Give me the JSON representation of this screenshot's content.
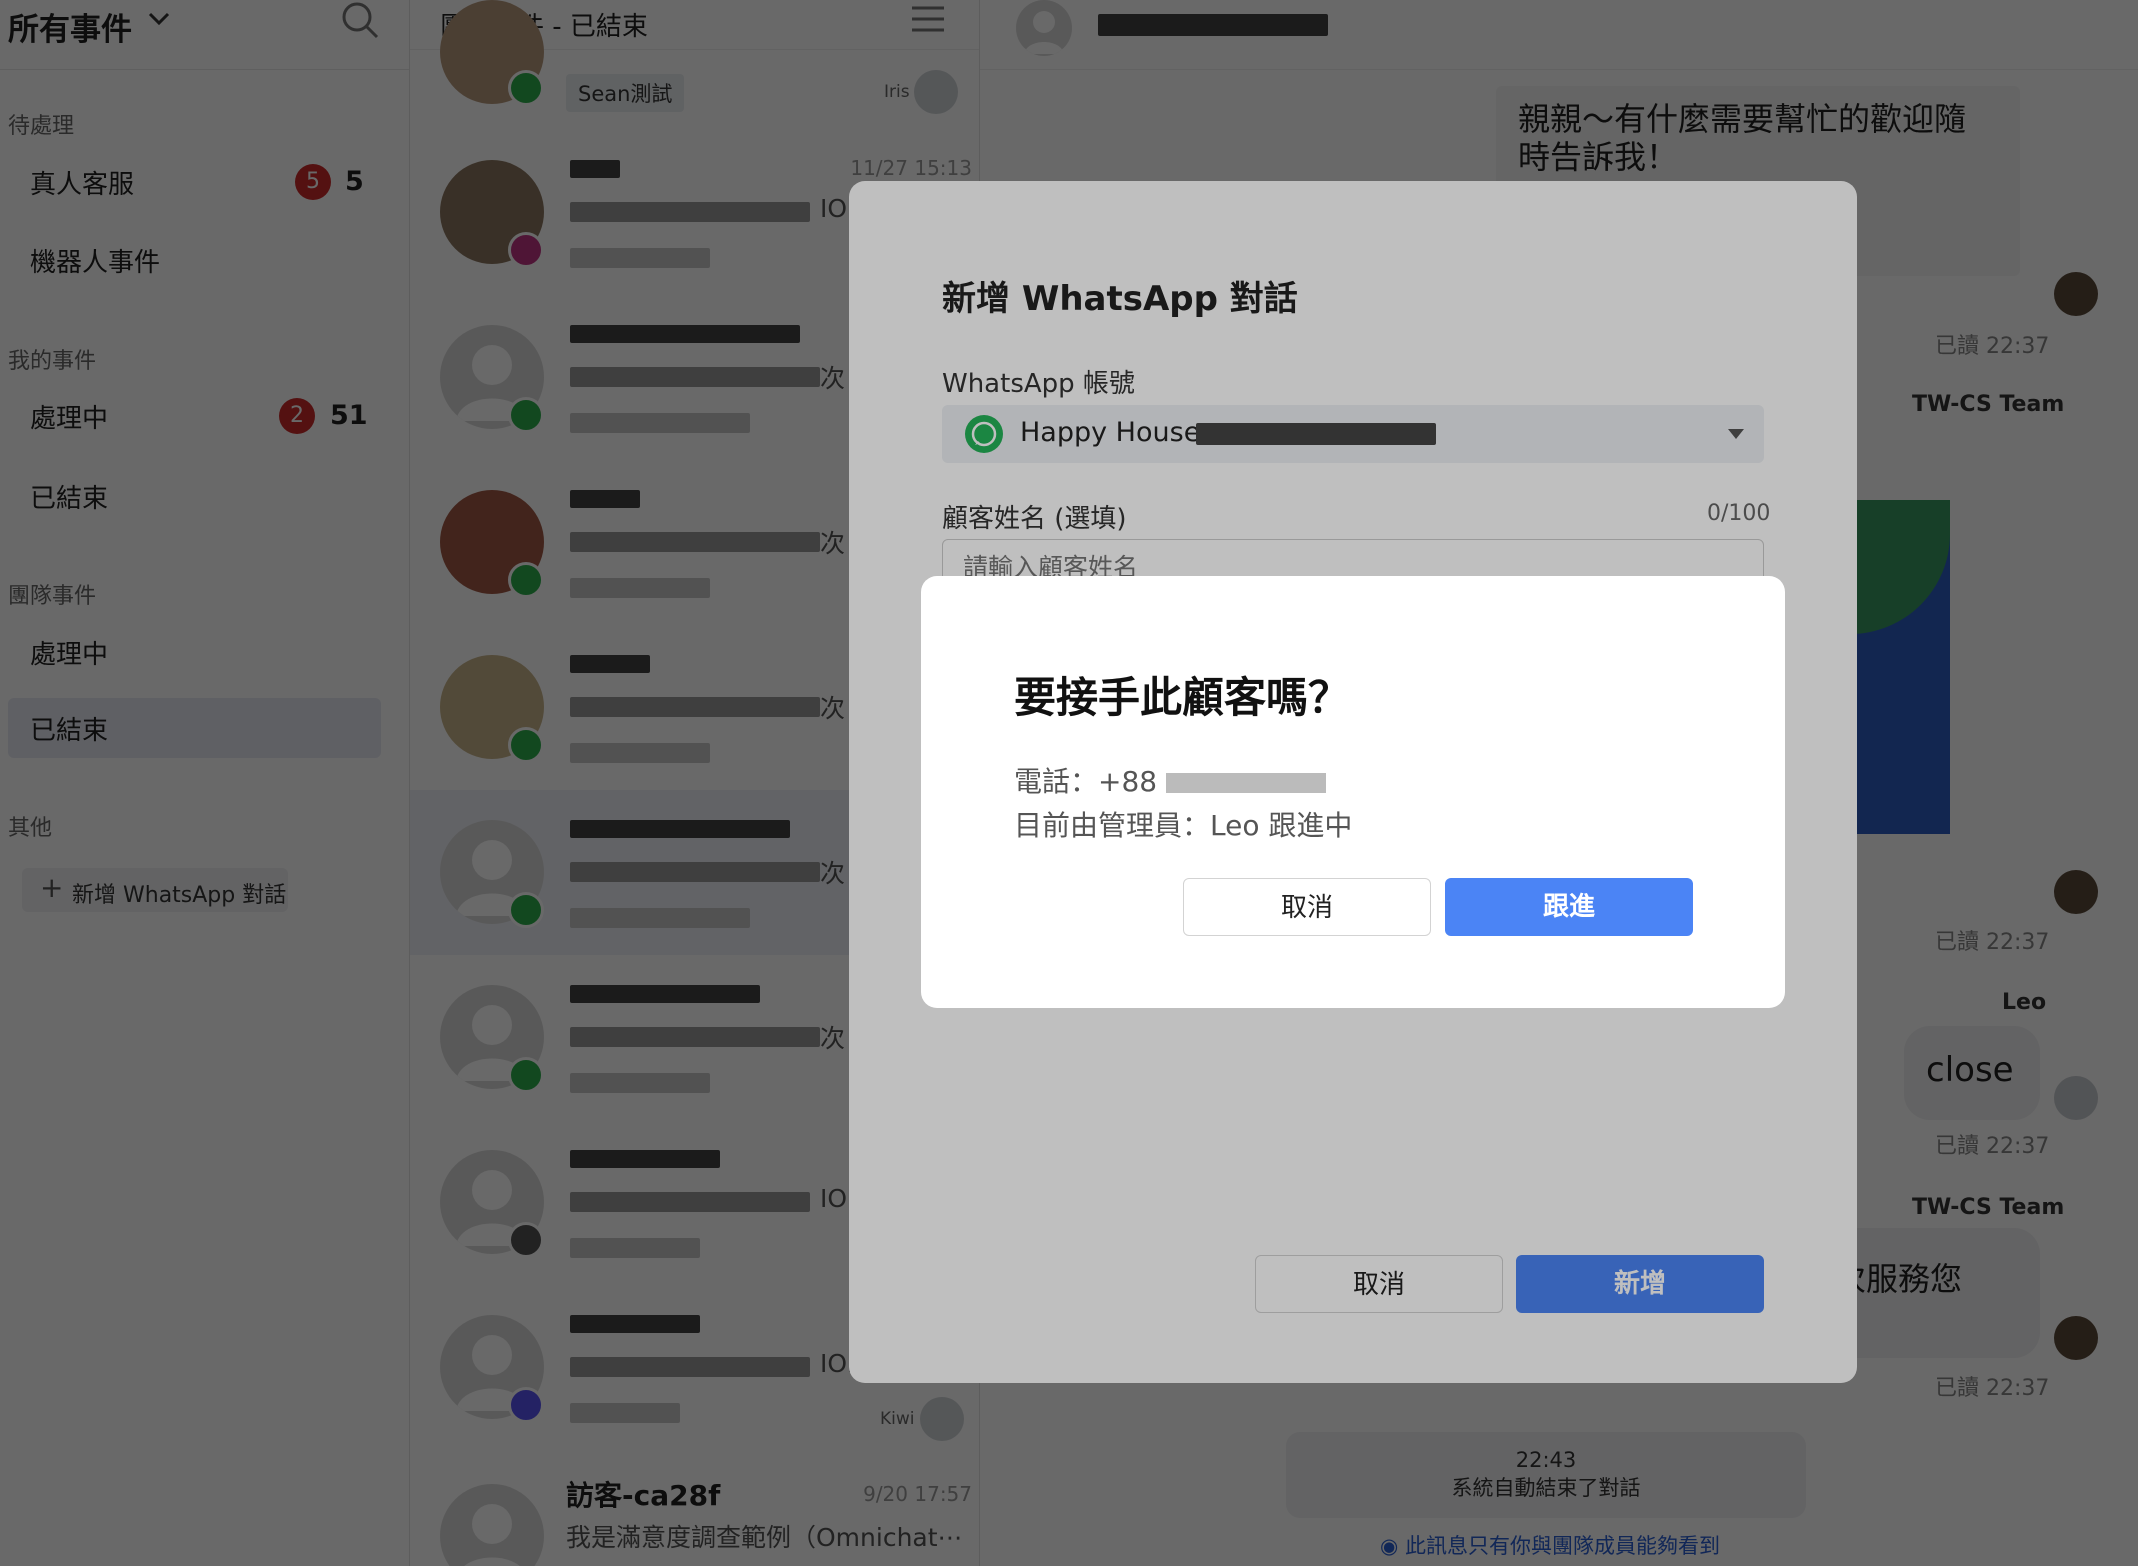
{
  "sidebar": {
    "title": "所有事件",
    "sections": {
      "pending": "待處理",
      "mine": "我的事件",
      "team": "團隊事件",
      "other": "其他"
    },
    "items": {
      "human": {
        "label": "真人客服",
        "badge": "5",
        "count": "5"
      },
      "bot": {
        "label": "機器人事件"
      },
      "mine_open": {
        "label": "處理中",
        "badge": "2",
        "count": "51"
      },
      "mine_closed": {
        "label": "已結束"
      },
      "team_open": {
        "label": "處理中"
      },
      "team_closed": {
        "label": "已結束"
      }
    },
    "new_whatsapp": "新增 WhatsApp 對話"
  },
  "list": {
    "title": "團隊事件 - 已結束",
    "first_tag": "Sean測試",
    "first_agent": "Iris",
    "items": [
      {
        "ts": "11/27 15:13",
        "preview_tail": "IOn"
      },
      {
        "ts": "",
        "preview_tail": "次"
      },
      {
        "ts": "",
        "preview_tail": "次"
      },
      {
        "ts": "",
        "preview_tail": "次"
      },
      {
        "ts": "",
        "preview_tail": "次"
      },
      {
        "ts": "",
        "preview_tail": "次"
      },
      {
        "ts": "",
        "preview_tail": "IOn"
      },
      {
        "ts": "",
        "preview_tail": "IOn",
        "agent": "Kiwi"
      },
      {
        "name": "訪客-ca28f",
        "ts": "9/20 17:57",
        "preview": "我是滿意度調查範例（Omnichat⋯"
      }
    ]
  },
  "chat": {
    "greeting": "親親～有什麼需要幫忙的歡迎隨時告訴我！",
    "greeting_line1": "親親～有什麼需要幫忙的歡迎隨",
    "greeting_line2": "時告訴我！",
    "read1": "已讀 22:37",
    "sender_team1": "TW-CS Team",
    "read2": "已讀 22:37",
    "sender_leo": "Leo",
    "close_msg": "close",
    "read3": "已讀 22:37",
    "sender_team2": "TW-CS Team",
    "service_msg": "次服務您",
    "read4": "已讀 22:37",
    "sys_time": "22:43",
    "sys_text": "系統自動結束了對話",
    "visibility_note": "此訊息只有你與團隊成員能夠看到"
  },
  "wa_modal": {
    "title": "新增 WhatsApp 對話",
    "account_label": "WhatsApp 帳號",
    "account_value": "Happy House",
    "name_label": "顧客姓名 (選填)",
    "name_counter": "0/100",
    "name_placeholder": "請輸入顧客姓名",
    "cancel": "取消",
    "create": "新增"
  },
  "confirm": {
    "title": "要接手此顧客嗎？",
    "phone_label": "電話：+88",
    "manager_line": "目前由管理員：Leo 跟進中",
    "cancel": "取消",
    "follow": "跟進"
  },
  "colors": {
    "primary": "#4b84f5",
    "badge": "#cc2b2b",
    "whatsapp": "#25b358",
    "line": "#2fb14e",
    "instagram": "#c13584",
    "messenger": "#5a54f5"
  }
}
